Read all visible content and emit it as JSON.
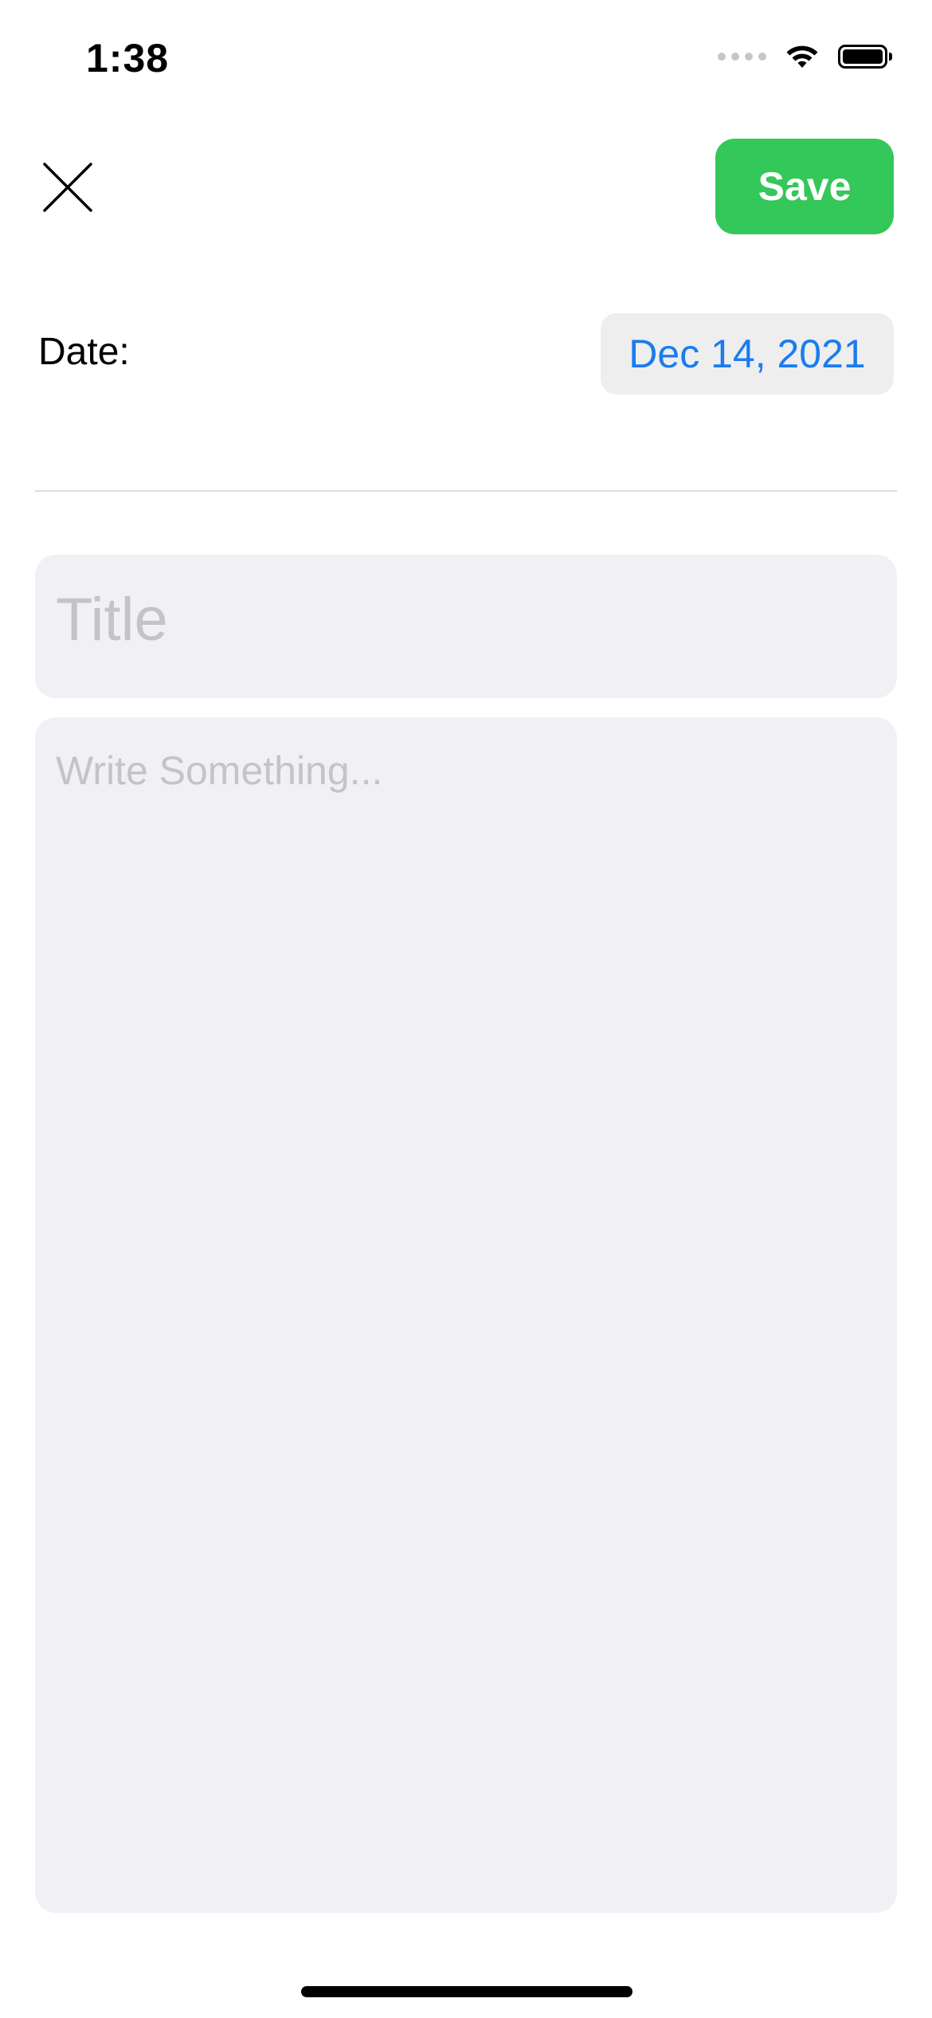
{
  "status_bar": {
    "time": "1:38",
    "icons": [
      "cellular-signal-icon",
      "wifi-icon",
      "battery-icon"
    ]
  },
  "header": {
    "close_icon": "close-icon",
    "save_label": "Save"
  },
  "date_row": {
    "label": "Date:",
    "value": "Dec 14, 2021"
  },
  "form": {
    "title_placeholder": "Title",
    "title_value": "",
    "body_placeholder": "Write Something...",
    "body_value": ""
  },
  "colors": {
    "save_button": "#34c759",
    "date_text": "#1a7cf0",
    "field_background": "#f1f1f5",
    "placeholder_text": "#c4c4c8"
  }
}
